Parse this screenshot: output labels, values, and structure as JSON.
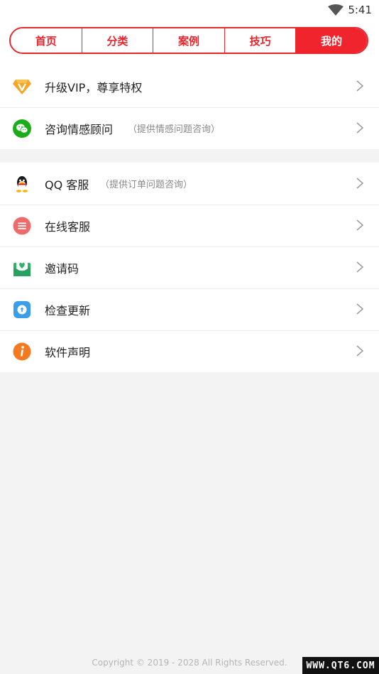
{
  "status_bar": {
    "time": "5:41",
    "wifi_icon": "wifi-icon"
  },
  "tabs": [
    {
      "label": "首页",
      "active": false
    },
    {
      "label": "分类",
      "active": false
    },
    {
      "label": "案例",
      "active": false
    },
    {
      "label": "技巧",
      "active": false
    },
    {
      "label": "我的",
      "active": true
    }
  ],
  "group1": {
    "items": [
      {
        "label": "升级VIP，尊享特权",
        "hint": "",
        "icon": "vip-diamond-icon"
      },
      {
        "label": "咨询情感顾问",
        "hint": "（提供情感问题咨询）",
        "icon": "wechat-icon"
      }
    ]
  },
  "group2": {
    "items": [
      {
        "label": "QQ 客服",
        "hint": "（提供订单问题咨询）",
        "icon": "qq-icon"
      },
      {
        "label": "在线客服",
        "hint": "",
        "icon": "online-service-icon"
      },
      {
        "label": "邀请码",
        "hint": "",
        "icon": "invite-code-icon"
      },
      {
        "label": "检查更新",
        "hint": "",
        "icon": "check-update-icon"
      },
      {
        "label": "软件声明",
        "hint": "",
        "icon": "info-icon"
      }
    ]
  },
  "footer": {
    "copyright": "Copyright © 2019 - 2028 All Rights Reserved."
  },
  "watermark": {
    "text": "WWW.QT6.COM"
  },
  "colors": {
    "accent": "#e8262c",
    "background": "#f3f3f3",
    "vip": "#f5a623",
    "wechat": "#1aad19",
    "online_service": "#ef6b6b",
    "invite": "#2fb36e",
    "update": "#3a9ee8",
    "info": "#f47a20"
  }
}
